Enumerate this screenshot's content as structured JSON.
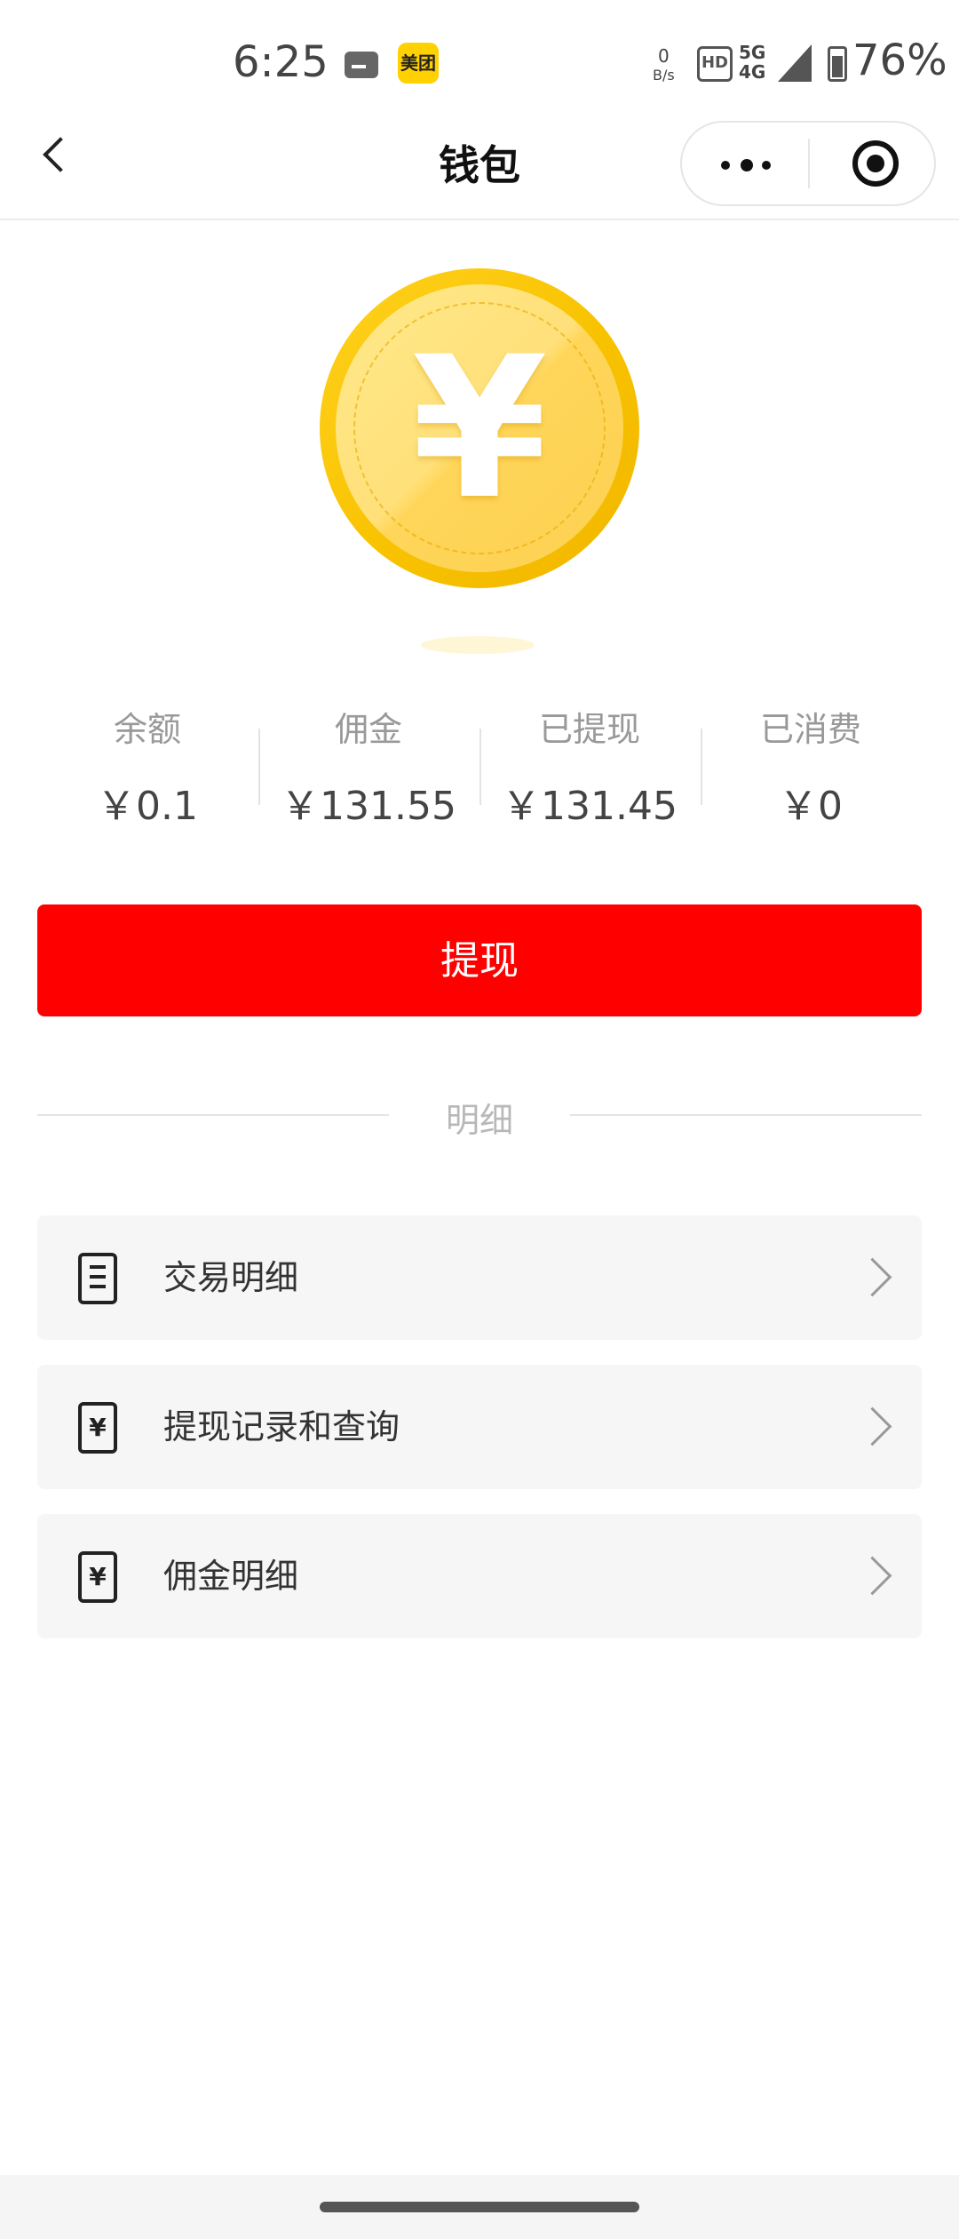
{
  "status_bar": {
    "time": "6:25",
    "meituan_label": "美团",
    "net_speed_value": "0",
    "net_speed_unit": "B/s",
    "sim_label": "HD",
    "network_top": "5G",
    "network_bottom": "4G",
    "battery": "76%"
  },
  "nav": {
    "title": "钱包"
  },
  "coin": {
    "symbol": "¥",
    "colors": {
      "outer": "#f8c200",
      "inner": "#ffe07a"
    }
  },
  "stats": [
    {
      "label": "余额",
      "value": "￥0.1"
    },
    {
      "label": "佣金",
      "value": "￥131.55"
    },
    {
      "label": "已提现",
      "value": "￥131.45"
    },
    {
      "label": "已消费",
      "value": "￥0"
    }
  ],
  "withdraw_button": {
    "label": "提现",
    "color": "#ff0000"
  },
  "section": {
    "title": "明细"
  },
  "list_items": [
    {
      "label": "交易明细",
      "icon": "document-icon"
    },
    {
      "label": "提现记录和查询",
      "icon": "yen-receipt-icon"
    },
    {
      "label": "佣金明细",
      "icon": "yen-receipt-icon"
    }
  ]
}
